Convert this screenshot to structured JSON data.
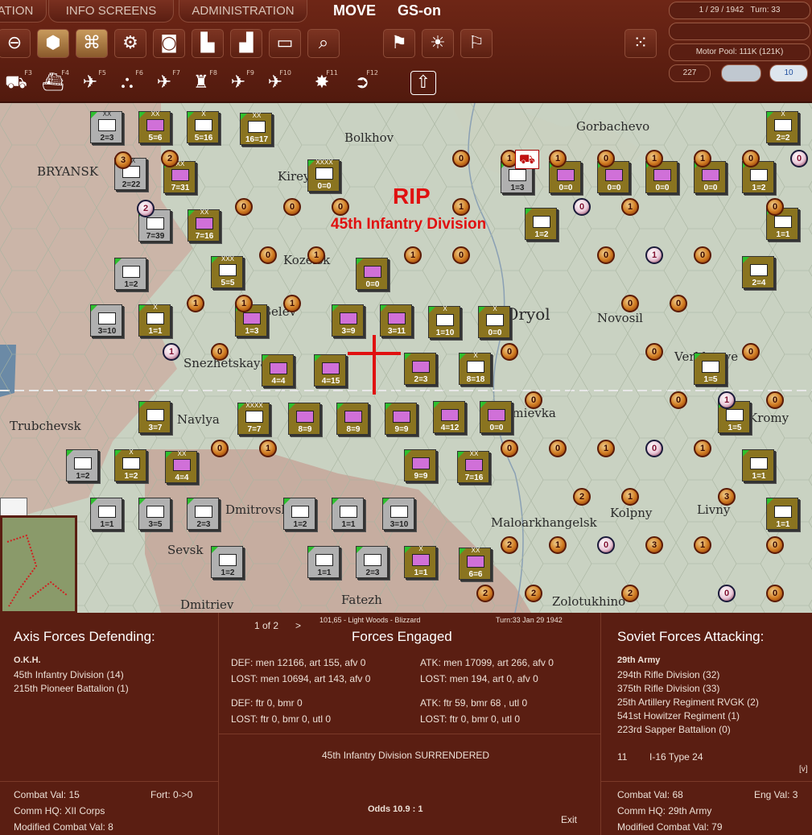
{
  "topbar": {
    "tabs": [
      "ATION",
      "INFO SCREENS",
      "ADMINISTRATION"
    ],
    "mode": "MOVE",
    "gs": "GS-on",
    "date": "1 / 29 / 1942",
    "turn": "Turn:  33",
    "motor_pool": "Motor Pool:  111K (121K)",
    "ap_left": "227",
    "ap_right": "10",
    "fkeys": [
      "F3",
      "F4",
      "F5",
      "F6",
      "F7",
      "F8",
      "F9",
      "F10",
      "F11",
      "F12"
    ]
  },
  "map": {
    "rip": "RIP",
    "rip_unit": "45th Infantry Division",
    "places": [
      "Bolkhov",
      "Gorbachevo",
      "BRYANSK",
      "Kireyevski",
      "Kozelsk",
      "Belev",
      "Oryol",
      "Novosil",
      "Verkhovye",
      "Snezhetskaya",
      "Trubchevsk",
      "Navlya",
      "Zmievka",
      "Kromy",
      "Dmitrovsk",
      "Maloarkhangelsk",
      "Livny",
      "Kolpny",
      "Sevsk",
      "Dmitriev",
      "Fatezh",
      "Zolotukhino"
    ]
  },
  "combat": {
    "pager": "1 of 2",
    "pager_arrow": ">",
    "location": "101,65 - Light Woods - Blizzard",
    "turn_date": "Turn:33  Jan 29 1942",
    "axis_title": "Axis Forces Defending:",
    "axis_hq": "O.K.H.",
    "axis_units": [
      "45th Infantry Division (14)",
      "215th Pioneer Battalion (1)"
    ],
    "engaged_title": "Forces Engaged",
    "def_men": "DEF: men 12166, art 155, afv 0",
    "def_lost": "LOST: men 10694, art 143, afv 0",
    "atk_men": "ATK: men 17099, art 266, afv 0",
    "atk_lost": "LOST: men 194, art 0, afv 0",
    "def_air": "DEF: ftr 0, bmr 0",
    "def_air_lost": "LOST: ftr 0, bmr 0, utl 0",
    "atk_air": "ATK: ftr 59, bmr 68 , utl 0",
    "atk_air_lost": "LOST: ftr 0, bmr 0, utl 0",
    "result": "45th Infantry Division SURRENDERED",
    "odds": "Odds 10.9 : 1",
    "exit": "Exit",
    "soviet_title": "Soviet Forces Attacking:",
    "soviet_hq": "29th Army",
    "soviet_units": [
      "294th Rifle Division (32)",
      "375th Rifle Division (33)",
      "25th Artillery Regiment RVGK (2)",
      "541st Howitzer Regiment (1)",
      "223rd Sapper Battalion (0)"
    ],
    "air_count": "11",
    "air_type": "I-16 Type 24",
    "more": "[v]",
    "axis_cv": "Combat Val: 15",
    "axis_fort": "Fort: 0->0",
    "axis_comm": "Comm HQ: XII Corps",
    "axis_mcv": "Modified Combat Val: 8",
    "sov_cv": "Combat Val: 68",
    "sov_eng": "Eng Val: 3",
    "sov_comm": "Comm HQ: 29th Army",
    "sov_mcv": "Modified Combat Val: 79"
  },
  "units": [
    {
      "sz": "XX",
      "sv": "2=3",
      "s": 1,
      "sym": "w"
    },
    {
      "sz": "XX",
      "sv": "5=6",
      "s": 0,
      "sym": "p"
    },
    {
      "sz": "X",
      "sv": "5=16",
      "s": 0,
      "sym": "w"
    },
    {
      "sz": "XX",
      "sv": "16=17",
      "s": 0,
      "sym": "w"
    },
    {
      "sz": "XX",
      "sv": "2=22",
      "s": 1,
      "sym": "w"
    },
    {
      "sz": "XX",
      "sv": "7=31",
      "s": 0,
      "sym": "p"
    },
    {
      "sz": "XXXX",
      "sv": "0=0",
      "s": 0,
      "sym": "w"
    },
    {
      "sz": "",
      "sv": "7=39",
      "s": 1,
      "sym": "w"
    },
    {
      "sz": "XX",
      "sv": "7=16",
      "s": 0,
      "sym": "p"
    },
    {
      "sz": "",
      "sv": "1=2",
      "s": 1,
      "sym": "w"
    },
    {
      "sz": "XXX",
      "sv": "5=5",
      "s": 0,
      "sym": "w"
    },
    {
      "sz": "",
      "sv": "0=0",
      "s": 0,
      "sym": "p"
    },
    {
      "sz": "",
      "sv": "3=10",
      "s": 1,
      "sym": "w"
    },
    {
      "sz": "X",
      "sv": "1=1",
      "s": 0,
      "sym": "w"
    },
    {
      "sz": "",
      "sv": "1=3",
      "s": 0,
      "sym": "p"
    },
    {
      "sz": "",
      "sv": "3=9",
      "s": 0,
      "sym": "p"
    },
    {
      "sz": "",
      "sv": "3=11",
      "s": 0,
      "sym": "p"
    },
    {
      "sz": "X",
      "sv": "1=10",
      "s": 0,
      "sym": "w"
    },
    {
      "sz": "X",
      "sv": "0=0",
      "s": 0,
      "sym": "w"
    },
    {
      "sz": "",
      "sv": "4=4",
      "s": 0,
      "sym": "p"
    },
    {
      "sz": "",
      "sv": "4=15",
      "s": 0,
      "sym": "p"
    },
    {
      "sz": "",
      "sv": "2=3",
      "s": 0,
      "sym": "p"
    },
    {
      "sz": "X",
      "sv": "8=18",
      "s": 0,
      "sym": "w"
    },
    {
      "sz": "",
      "sv": "3=7",
      "s": 0,
      "sym": "w"
    },
    {
      "sz": "XXXX",
      "sv": "7=7",
      "s": 0,
      "sym": "w"
    },
    {
      "sz": "",
      "sv": "8=9",
      "s": 0,
      "sym": "p"
    },
    {
      "sz": "",
      "sv": "8=9",
      "s": 0,
      "sym": "p"
    },
    {
      "sz": "",
      "sv": "9=9",
      "s": 0,
      "sym": "p"
    },
    {
      "sz": "",
      "sv": "4=12",
      "s": 0,
      "sym": "p"
    },
    {
      "sz": "",
      "sv": "0=0",
      "s": 0,
      "sym": "p"
    },
    {
      "sz": "",
      "sv": "1=2",
      "s": 1,
      "sym": "w"
    },
    {
      "sz": "X",
      "sv": "1=2",
      "s": 0,
      "sym": "w"
    },
    {
      "sz": "XX",
      "sv": "4=4",
      "s": 0,
      "sym": "p"
    },
    {
      "sz": "",
      "sv": "9=9",
      "s": 0,
      "sym": "p"
    },
    {
      "sz": "XX",
      "sv": "7=16",
      "s": 0,
      "sym": "p"
    },
    {
      "sz": "",
      "sv": "1=1",
      "s": 1,
      "sym": "w"
    },
    {
      "sz": "",
      "sv": "3=5",
      "s": 1,
      "sym": "w"
    },
    {
      "sz": "",
      "sv": "2=3",
      "s": 1,
      "sym": "w"
    },
    {
      "sz": "",
      "sv": "1=2",
      "s": 1,
      "sym": "w"
    },
    {
      "sz": "",
      "sv": "1=1",
      "s": 1,
      "sym": "w"
    },
    {
      "sz": "",
      "sv": "3=10",
      "s": 1,
      "sym": "w"
    },
    {
      "sz": "",
      "sv": "1=1",
      "s": 1,
      "sym": "w"
    },
    {
      "sz": "",
      "sv": "2=3",
      "s": 1,
      "sym": "w"
    },
    {
      "sz": "",
      "sv": "1=2",
      "s": 1,
      "sym": "w"
    },
    {
      "sz": "X",
      "sv": "1=1",
      "s": 0,
      "sym": "p"
    },
    {
      "sz": "XX",
      "sv": "6=6",
      "s": 0,
      "sym": "p"
    },
    {
      "sz": "",
      "sv": "1=3",
      "s": 1,
      "sym": "w"
    },
    {
      "sz": "",
      "sv": "0=0",
      "s": 0,
      "sym": "p"
    },
    {
      "sz": "",
      "sv": "0=0",
      "s": 0,
      "sym": "p"
    },
    {
      "sz": "",
      "sv": "0=0",
      "s": 0,
      "sym": "p"
    },
    {
      "sz": "",
      "sv": "0=0",
      "s": 0,
      "sym": "p"
    },
    {
      "sz": "",
      "sv": "1=2",
      "s": 0,
      "sym": "w"
    },
    {
      "sz": "X",
      "sv": "2=2",
      "s": 0,
      "sym": "w"
    },
    {
      "sz": "",
      "sv": "1=2",
      "s": 0,
      "sym": "w"
    },
    {
      "sz": "",
      "sv": "1=1",
      "s": 0,
      "sym": "w"
    },
    {
      "sz": "",
      "sv": "2=4",
      "s": 0,
      "sym": "w"
    },
    {
      "sz": "",
      "sv": "1=5",
      "s": 0,
      "sym": "w"
    },
    {
      "sz": "",
      "sv": "1=5",
      "s": 0,
      "sym": "w"
    },
    {
      "sz": "",
      "sv": "1=1",
      "s": 0,
      "sym": "w"
    },
    {
      "sz": "",
      "sv": "1=1",
      "s": 0,
      "sym": "w"
    }
  ],
  "markers": [
    "3",
    "2",
    "2",
    "0",
    "0",
    "0",
    "0",
    "1",
    "1",
    "0",
    "1",
    "0",
    "1",
    "1",
    "0",
    "0",
    "1",
    "0",
    "1",
    "1",
    "1",
    "0",
    "0",
    "1",
    "0",
    "0",
    "0",
    "0",
    "0",
    "0",
    "1",
    "0",
    "0",
    "1",
    "0",
    "0",
    "1",
    "0",
    "1",
    "3",
    "2",
    "1",
    "2",
    "1",
    "0",
    "3",
    "1",
    "0",
    "2",
    "2",
    "2",
    "0",
    "0",
    "1",
    "0",
    "1",
    "1",
    "0",
    "0",
    "0"
  ]
}
